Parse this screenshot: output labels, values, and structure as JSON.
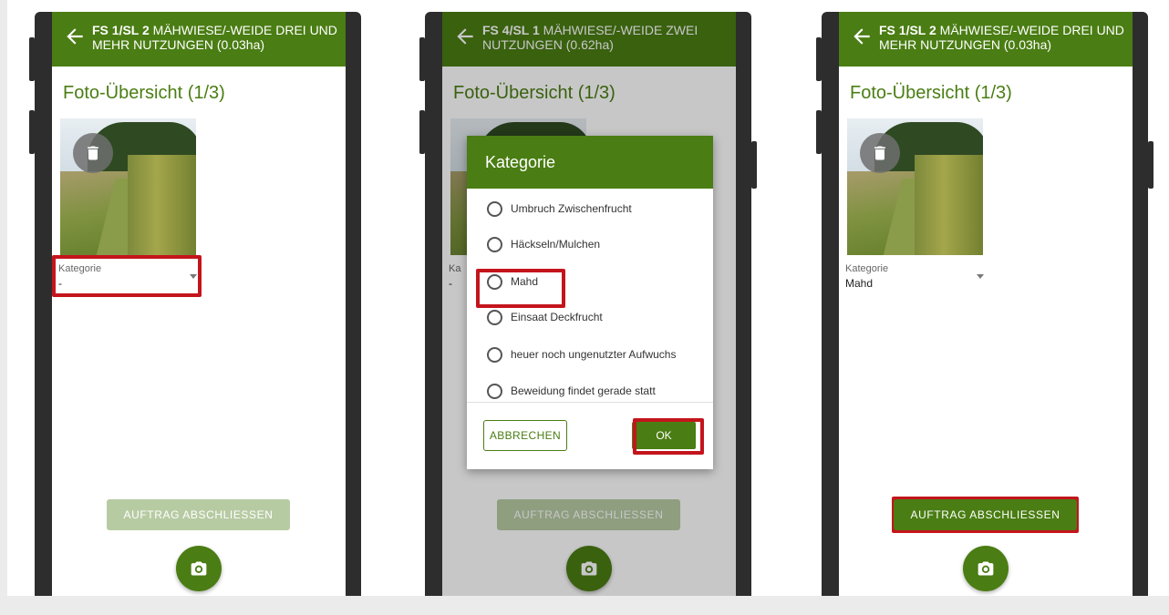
{
  "screens": [
    {
      "header_bold": "FS 1/SL 2",
      "header_text": " MÄHWIESE/-WEIDE DREI UND MEHR NUTZUNGEN (0.03ha)",
      "title": "Foto-Übersicht (1/3)",
      "kategorie_label": "Kategorie",
      "kategorie_value": "-",
      "finish_label": "AUFTRAG ABSCHLIESSEN",
      "finish_enabled": false
    },
    {
      "header_bold": "FS 4/SL 1",
      "header_text": " MÄHWIESE/-WEIDE ZWEI NUTZUNGEN (0.62ha)",
      "title": "Foto-Übersicht (1/3)",
      "kategorie_label": "Ka",
      "kategorie_value": "-",
      "finish_label": "AUFTRAG ABSCHLIESSEN",
      "finish_enabled": false,
      "dialog": {
        "title": "Kategorie",
        "options": [
          "Umbruch Zwischenfrucht",
          "Häckseln/Mulchen",
          "Mahd",
          "Einsaat Deckfrucht",
          "heuer noch ungenutzter Aufwuchs",
          "Beweidung findet gerade statt"
        ],
        "cancel_label": "ABBRECHEN",
        "ok_label": "OK"
      }
    },
    {
      "header_bold": "FS 1/SL 2",
      "header_text": " MÄHWIESE/-WEIDE DREI UND MEHR NUTZUNGEN (0.03ha)",
      "title": "Foto-Übersicht (1/3)",
      "kategorie_label": "Kategorie",
      "kategorie_value": "Mahd",
      "finish_label": "AUFTRAG ABSCHLIESSEN",
      "finish_enabled": true
    }
  ],
  "colors": {
    "primary": "#4a7d13",
    "primary_disabled": "#b7cba3",
    "highlight": "#c4151c"
  },
  "icons": {
    "back": "arrow-left-icon",
    "delete": "trash-icon",
    "camera": "camera-icon"
  }
}
